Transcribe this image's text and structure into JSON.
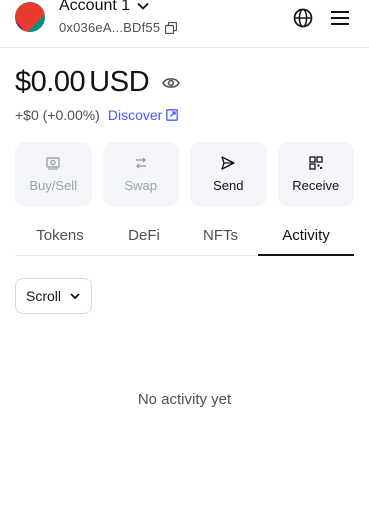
{
  "account": {
    "name": "Account 1",
    "address": "0x036eA...BDf55"
  },
  "balance": {
    "amount": "$0.00",
    "currency": "USD",
    "change": "+$0 (+0.00%)",
    "discover_label": "Discover"
  },
  "actions": [
    {
      "label": "Buy/Sell",
      "icon": "card-icon",
      "enabled": false
    },
    {
      "label": "Swap",
      "icon": "swap-icon",
      "enabled": false
    },
    {
      "label": "Send",
      "icon": "send-icon",
      "enabled": true
    },
    {
      "label": "Receive",
      "icon": "qr-icon",
      "enabled": true
    }
  ],
  "tabs": [
    {
      "label": "Tokens",
      "active": false
    },
    {
      "label": "DeFi",
      "active": false
    },
    {
      "label": "NFTs",
      "active": false
    },
    {
      "label": "Activity",
      "active": true
    }
  ],
  "filter": {
    "selected": "Scroll"
  },
  "empty_state": "No activity yet",
  "colors": {
    "accent": "#4459ff",
    "text_primary": "#121314",
    "text_secondary": "#4b505c",
    "disabled": "#9ca1ab",
    "button_bg": "#f3f5f9"
  }
}
